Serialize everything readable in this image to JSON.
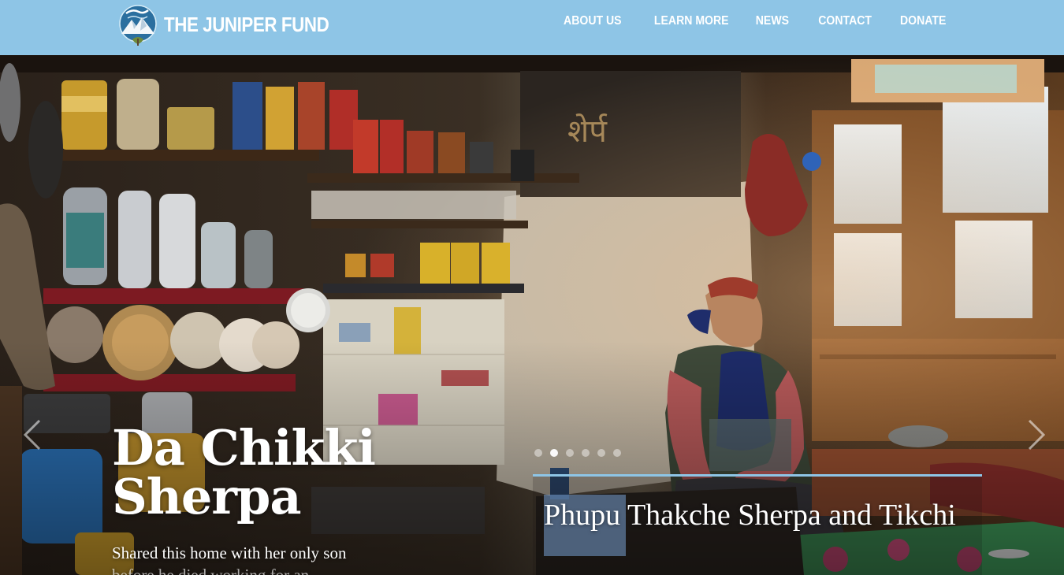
{
  "header": {
    "brand": "THE JUNIPER FUND",
    "logo_icon": "mountain-logo-icon",
    "nav": [
      {
        "label": "ABOUT US"
      },
      {
        "label": "LEARN MORE"
      },
      {
        "label": "NEWS"
      },
      {
        "label": "CONTACT"
      },
      {
        "label": "DONATE"
      }
    ]
  },
  "slide": {
    "title": "Da Chikki Sherpa",
    "subtitle_line1": "Shared this home with her only son",
    "subtitle_line2": "before he died working for an",
    "caption": "Phupu Thakche Sherpa and Tikchi",
    "dot_count": 6,
    "active_dot": 2,
    "prev_icon": "chevron-left-icon",
    "next_icon": "chevron-right-icon"
  },
  "colors": {
    "header_bg": "#8ec5e6",
    "accent": "#8ec5e6",
    "text": "#ffffff"
  }
}
